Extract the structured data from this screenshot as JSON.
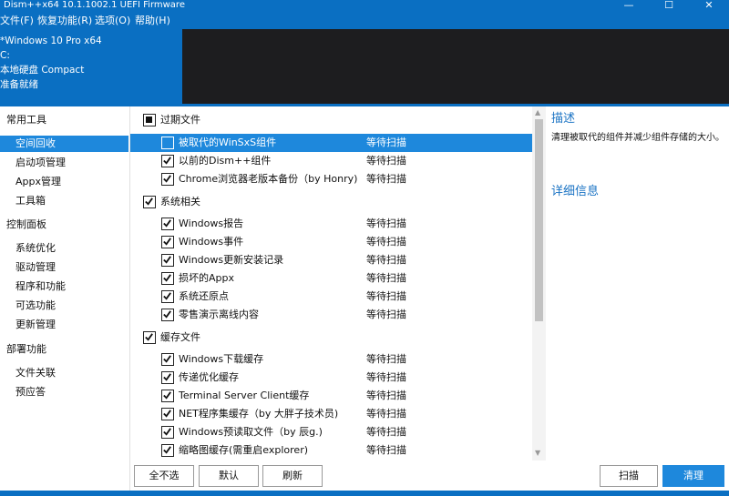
{
  "window": {
    "title": "Dism++x64 10.1.1002.1 UEFI Firmware",
    "minimize": "—",
    "maximize": "☐",
    "close": "✕"
  },
  "menu": [
    "文件(F)",
    "恢复功能(R)",
    "选项(O)",
    "帮助(H)"
  ],
  "info": [
    "*Windows 10 Pro x64",
    "C:",
    "本地硬盘 Compact",
    "准备就绪"
  ],
  "sidebar": {
    "groups": [
      {
        "heading": "常用工具",
        "items": [
          "空间回收",
          "启动项管理",
          "Appx管理",
          "工具箱"
        ]
      },
      {
        "heading": "控制面板",
        "items": [
          "系统优化",
          "驱动管理",
          "程序和功能",
          "可选功能",
          "更新管理"
        ]
      },
      {
        "heading": "部署功能",
        "items": [
          "文件关联",
          "预应答"
        ]
      }
    ],
    "active": "空间回收"
  },
  "cleanup": {
    "groups": [
      {
        "label": "过期文件",
        "state": "partial",
        "items": [
          {
            "label": "被取代的WinSxS组件",
            "status": "等待扫描",
            "checked": false,
            "selected": true
          },
          {
            "label": "以前的Dism++组件",
            "status": "等待扫描",
            "checked": true
          },
          {
            "label": "Chrome浏览器老版本备份（by Honry)",
            "status": "等待扫描",
            "checked": true
          }
        ]
      },
      {
        "label": "系统相关",
        "state": "checked",
        "items": [
          {
            "label": "Windows报告",
            "status": "等待扫描",
            "checked": true
          },
          {
            "label": "Windows事件",
            "status": "等待扫描",
            "checked": true
          },
          {
            "label": "Windows更新安装记录",
            "status": "等待扫描",
            "checked": true
          },
          {
            "label": "损坏的Appx",
            "status": "等待扫描",
            "checked": true
          },
          {
            "label": "系统还原点",
            "status": "等待扫描",
            "checked": true
          },
          {
            "label": "零售演示离线内容",
            "status": "等待扫描",
            "checked": true
          }
        ]
      },
      {
        "label": "缓存文件",
        "state": "checked",
        "items": [
          {
            "label": "Windows下载缓存",
            "status": "等待扫描",
            "checked": true
          },
          {
            "label": "传递优化缓存",
            "status": "等待扫描",
            "checked": true
          },
          {
            "label": "Terminal Server Client缓存",
            "status": "等待扫描",
            "checked": true
          },
          {
            "label": "NET程序集缓存（by 大胖子技术员)",
            "status": "等待扫描",
            "checked": true
          },
          {
            "label": "Windows预读取文件（by 辰g.)",
            "status": "等待扫描",
            "checked": true
          },
          {
            "label": "缩略图缓存(需重启explorer)",
            "status": "等待扫描",
            "checked": true
          }
        ]
      }
    ]
  },
  "description": {
    "title": "描述",
    "text": "清理被取代的组件并减少组件存储的大小。",
    "detail_title": "详细信息"
  },
  "buttons": {
    "deselect_all": "全不选",
    "default": "默认",
    "refresh": "刷新",
    "scan": "扫描",
    "clean": "清理"
  },
  "colors": {
    "accent": "#0a6fc2",
    "selection": "#1e88dc",
    "heading": "#1a73c4",
    "dark_panel": "#1d1d1f"
  }
}
